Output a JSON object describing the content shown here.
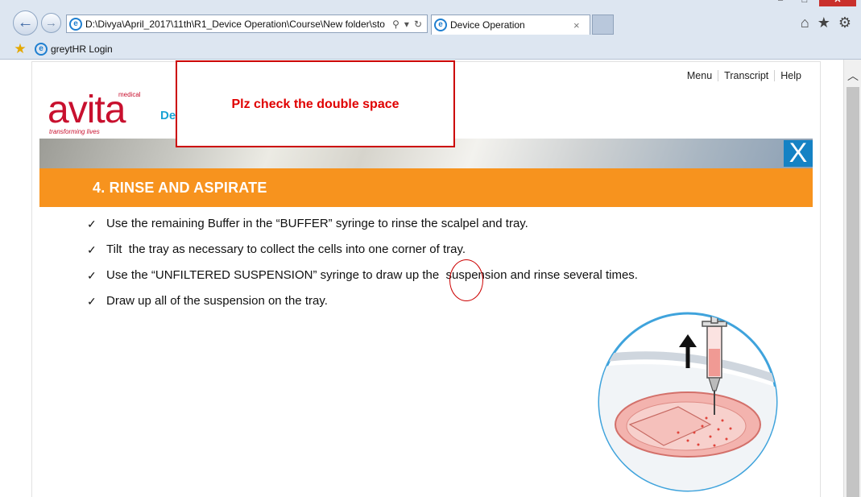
{
  "browser": {
    "address": "D:\\Divya\\April_2017\\11th\\R1_Device Operation\\Course\\New folder\\sto",
    "tab_title": "Device Operation",
    "tab_close": "×",
    "favorites": [
      {
        "label": "greytHR Login"
      }
    ],
    "icons": [
      "back-icon",
      "forward-icon",
      "ie-icon",
      "search-icon",
      "dropdown-icon",
      "refresh-icon",
      "home-icon",
      "favorites-star-icon",
      "settings-gear-icon",
      "minimize-icon",
      "maximize-icon",
      "close-icon"
    ]
  },
  "course": {
    "nav": [
      "Menu",
      "Transcript",
      "Help"
    ],
    "logo": {
      "wordmark": "avita",
      "superscript": "medical",
      "tagline": "transforming lives"
    },
    "title_partial": "De",
    "close_label": "X",
    "section_title": "4. RINSE AND ASPIRATE",
    "bullets": [
      "Use the remaining Buffer in the “BUFFER” syringe to rinse the scalpel and tray.",
      "Tilt  the tray as necessary to collect the cells into one corner of tray.",
      "Use the “UNFILTERED SUSPENSION” syringe to draw up the  suspension and rinse several times.",
      "Draw up all of the suspension on the tray."
    ],
    "check_glyph": "✓"
  },
  "annotation": {
    "text": "Plz check the double space",
    "color": "#cc0000"
  },
  "colors": {
    "accent_orange": "#f7931e",
    "brand_red": "#c8102e",
    "close_blue": "#1582c4",
    "title_cyan": "#1aa3d4"
  }
}
